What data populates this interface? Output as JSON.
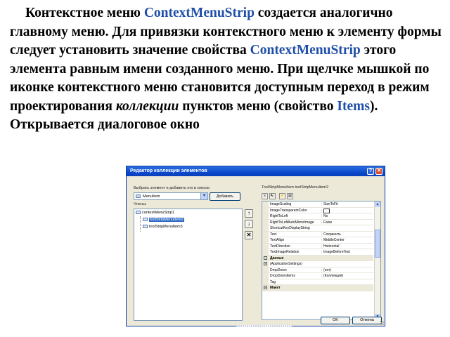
{
  "paragraph": {
    "t1": "Контекстное меню ",
    "term1": "ContextMenuStrip",
    "t2": " создается аналогично главному меню. Для привязки контекстного меню к элементу формы следует установить значение свойства ",
    "term2": "ContextMenuStrip",
    "t3": " этого элемента равным имени созданного меню. При щелчке мышкой по иконке контекстного меню становится доступным переход в режим проектирования ",
    "italic": "коллекции",
    "t4": " пунктов меню (свойство ",
    "term3": "Items",
    "t5": "). Открывается диалоговое окно"
  },
  "dialog": {
    "title": "Редактор коллекции элементов",
    "help_label": "?",
    "close_label": "✕",
    "select_label": "Выбрать элемент и добавить его в список:",
    "combo_value": "MenuItem",
    "add_button": "Добавить",
    "members_label": "Члены:",
    "tree": [
      {
        "text": "contextMenuStrip1",
        "selected": false
      },
      {
        "text": "toolStripMenuItem2",
        "selected": true
      },
      {
        "text": "toolStripMenuItem3",
        "selected": false
      }
    ],
    "move_up": "↑",
    "move_down": "↓",
    "remove": "✕",
    "props_heading": "ToolStripMenuItem   toolStripMenuItem2",
    "toolbar": [
      "≡",
      "A↓",
      "⚡",
      "▤"
    ],
    "properties": [
      {
        "name": "ImageScaling",
        "value": "SizeToFit",
        "cat": false
      },
      {
        "name": "ImageTransparentColor",
        "value": "",
        "cat": false,
        "colorbox": true
      },
      {
        "name": "RightToLeft",
        "value": "No",
        "cat": false
      },
      {
        "name": "RightToLeftAutoMirrorImage",
        "value": "False",
        "cat": false
      },
      {
        "name": "ShortcutKeyDisplayString",
        "value": "",
        "cat": false
      },
      {
        "name": "Text",
        "value": "Сохранить",
        "cat": false
      },
      {
        "name": "TextAlign",
        "value": "MiddleCenter",
        "cat": false
      },
      {
        "name": "TextDirection",
        "value": "Horizontal",
        "cat": false
      },
      {
        "name": "TextImageRelation",
        "value": "ImageBeforeText",
        "cat": false
      },
      {
        "name": "Данные",
        "value": "",
        "cat": true,
        "toggle": "−"
      },
      {
        "name": "(ApplicationSettings)",
        "value": "",
        "cat": false,
        "toggle": "+"
      },
      {
        "name": "DropDown",
        "value": "(нет)",
        "cat": false
      },
      {
        "name": "DropDownItems",
        "value": "(Коллекция)",
        "cat": false
      },
      {
        "name": "Tag",
        "value": "",
        "cat": false
      },
      {
        "name": "Макет",
        "value": "",
        "cat": true,
        "toggle": "−"
      }
    ],
    "ok_button": "OK",
    "cancel_button": "Отмена"
  },
  "colors": {
    "term": "#1f4fa8",
    "titlebar": "#0a45c8",
    "dialog_bg": "#ece9d8"
  }
}
